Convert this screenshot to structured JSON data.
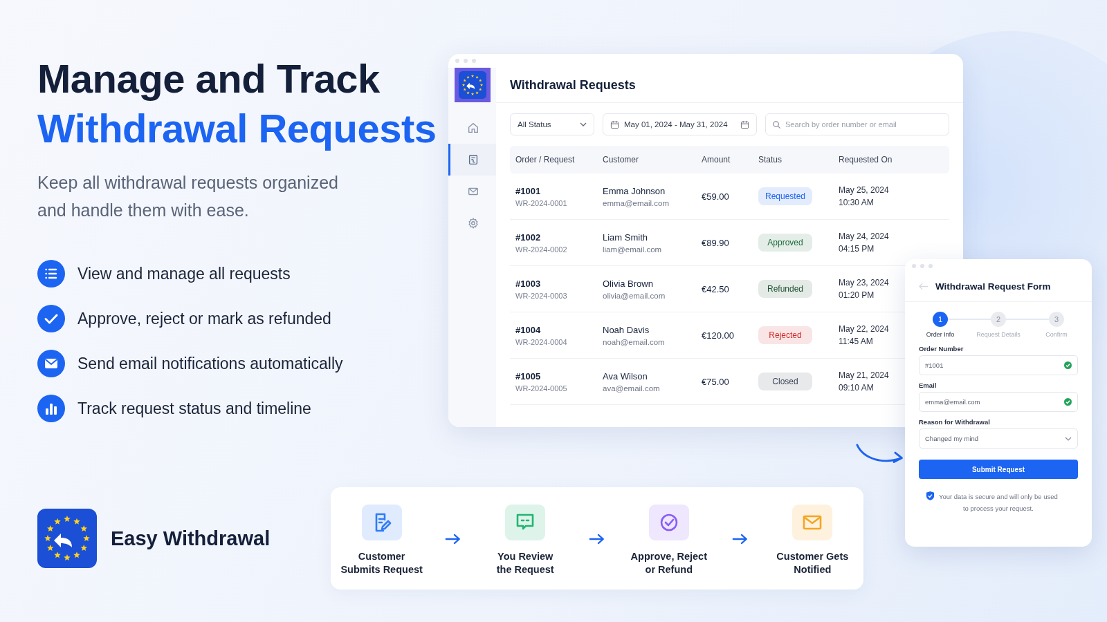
{
  "hero": {
    "title_line1": "Manage and Track",
    "title_line2": "Withdrawal Requests",
    "subtitle_lines": [
      "Keep all withdrawal requests organized",
      "and handle them with ease."
    ]
  },
  "features": [
    {
      "kind": "list",
      "label": "View and manage all requests"
    },
    {
      "kind": "check",
      "label": "Approve, reject or mark as refunded"
    },
    {
      "kind": "mail",
      "label": "Send email notifications automatically"
    },
    {
      "kind": "chart",
      "label": "Track request status and timeline"
    }
  ],
  "brand": {
    "name": "Easy Withdrawal"
  },
  "dashboard": {
    "title": "Withdrawal Requests",
    "nav": [
      {
        "kind": "home",
        "selected": false
      },
      {
        "kind": "document",
        "selected": true
      },
      {
        "kind": "mail",
        "selected": false
      },
      {
        "kind": "gear",
        "selected": false
      }
    ],
    "filters": {
      "status": "All Status",
      "date_range": "May 01, 2024 - May 31, 2024",
      "search_placeholder": "Search by order number or email"
    },
    "columns": [
      "Order / Request",
      "Customer",
      "Amount",
      "Status",
      "Requested On"
    ],
    "rows": [
      {
        "order": "#1001",
        "request": "WR-2024-0001",
        "customer": "Emma Johnson",
        "email": "emma@email.com",
        "amount": "€59.00",
        "status": "Requested",
        "color": "#1c64f2",
        "date": "May 25, 2024",
        "time": "10:30 AM"
      },
      {
        "order": "#1002",
        "request": "WR-2024-0002",
        "customer": "Liam Smith",
        "email": "liam@email.com",
        "amount": "€89.90",
        "status": "Approved",
        "color": "#1f6b3d",
        "date": "May 24, 2024",
        "time": "04:15 PM"
      },
      {
        "order": "#1003",
        "request": "WR-2024-0003",
        "customer": "Olivia Brown",
        "email": "olivia@email.com",
        "amount": "€42.50",
        "status": "Refunded",
        "color": "#1f5132",
        "date": "May 23, 2024",
        "time": "01:20 PM"
      },
      {
        "order": "#1004",
        "request": "WR-2024-0004",
        "customer": "Noah Davis",
        "email": "noah@email.com",
        "amount": "€120.00",
        "status": "Rejected",
        "color": "#d12b2b",
        "date": "May 22, 2024",
        "time": "11:45 AM"
      },
      {
        "order": "#1005",
        "request": "WR-2024-0005",
        "customer": "Ava Wilson",
        "email": "ava@email.com",
        "amount": "€75.00",
        "status": "Closed",
        "color": "#3e4658",
        "date": "May 21, 2024",
        "time": "09:10 AM"
      }
    ]
  },
  "form": {
    "title": "Withdrawal Request Form",
    "steps": [
      {
        "number": "1",
        "label": "Order Info",
        "selected": true
      },
      {
        "number": "2",
        "label": "Request Details",
        "selected": false
      },
      {
        "number": "3",
        "label": "Confirm",
        "selected": false
      }
    ],
    "fields": [
      {
        "kind": "text",
        "label": "Order Number",
        "value": "#1001",
        "valid": true
      },
      {
        "kind": "text",
        "label": "Email",
        "value": "emma@email.com",
        "valid": true
      },
      {
        "kind": "select",
        "label": "Reason for Withdrawal",
        "value": "Changed my mind"
      }
    ],
    "submit": "Submit Request",
    "note_lines": [
      "Your data is secure and will only be used",
      "to process your request."
    ]
  },
  "process": [
    {
      "kind": "form",
      "label_lines": [
        "Customer",
        "Submits Request"
      ]
    },
    {
      "kind": "chat",
      "label_lines": [
        "You Review",
        "the Request"
      ]
    },
    {
      "kind": "check",
      "label_lines": [
        "Approve, Reject",
        "or Refund"
      ]
    },
    {
      "kind": "mail",
      "label_lines": [
        "Customer Gets",
        "Notified"
      ]
    }
  ]
}
